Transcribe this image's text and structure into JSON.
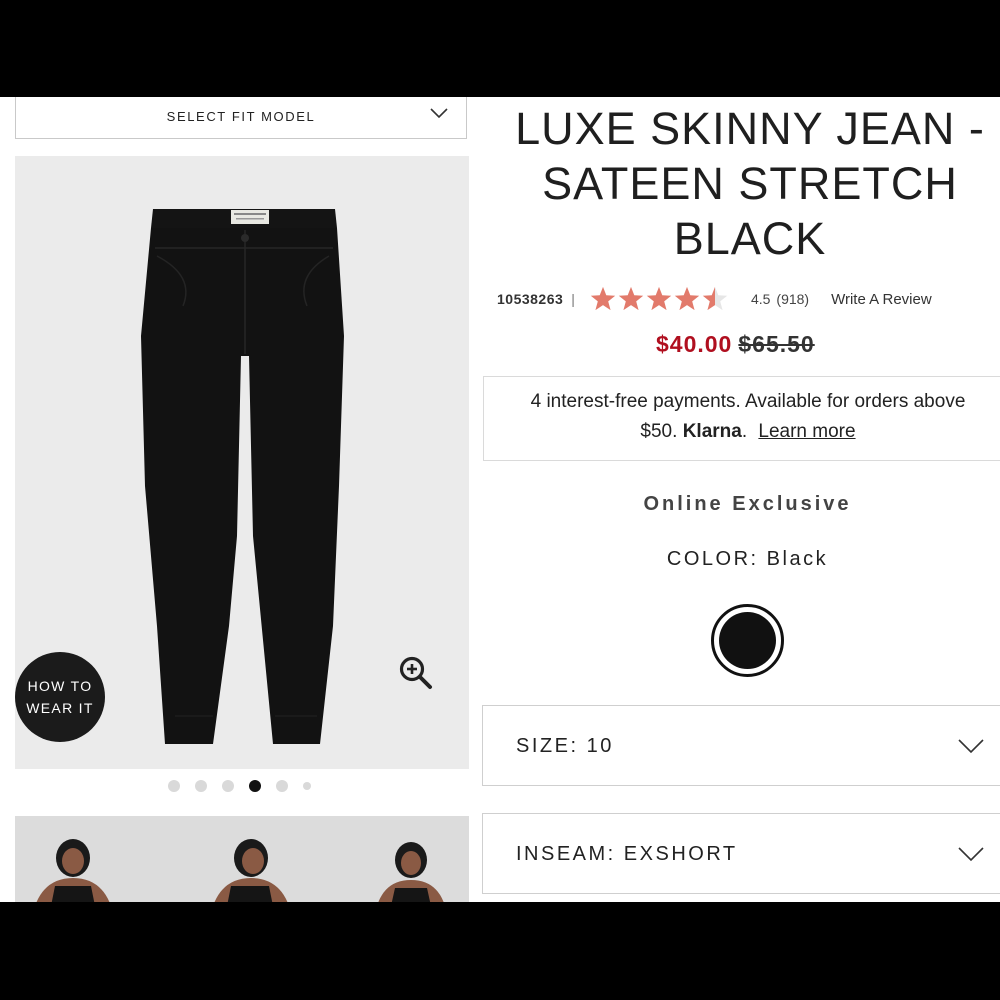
{
  "fit_select": {
    "label": "SELECT FIT MODEL"
  },
  "product": {
    "title_lines": [
      "LUXE SKINNY JEAN -",
      "SATEEN STRETCH",
      "BLACK"
    ],
    "sku": "10538263",
    "separator": "|",
    "rating": 4.5,
    "rating_text": "4.5",
    "review_count": "(918)",
    "write_review": "Write A Review",
    "sale_price": "$40.00",
    "original_price": "$65.50"
  },
  "klarna": {
    "line1": "4 interest-free payments. Available for orders above",
    "line2_prefix": "$50.",
    "brand": "Klarna",
    "brand_suffix": ".",
    "learn_more": "Learn more"
  },
  "badge": "Online Exclusive",
  "color": {
    "label": "COLOR: Black",
    "swatch_hex": "#111111"
  },
  "size_select": {
    "label": "SIZE: 10"
  },
  "inseam_select": {
    "label": "INSEAM: EXSHORT"
  },
  "image_overlay": {
    "how_to_line1": "HOW TO",
    "how_to_line2": "WEAR IT"
  },
  "carousel": {
    "total": 6,
    "active_index": 3
  },
  "colors": {
    "sale_red": "#b00f1f",
    "star_salmon": "#e27a6b",
    "star_empty": "#e6e6e6"
  },
  "icons": [
    "chevron-down-icon",
    "zoom-in-icon",
    "star-icon"
  ]
}
